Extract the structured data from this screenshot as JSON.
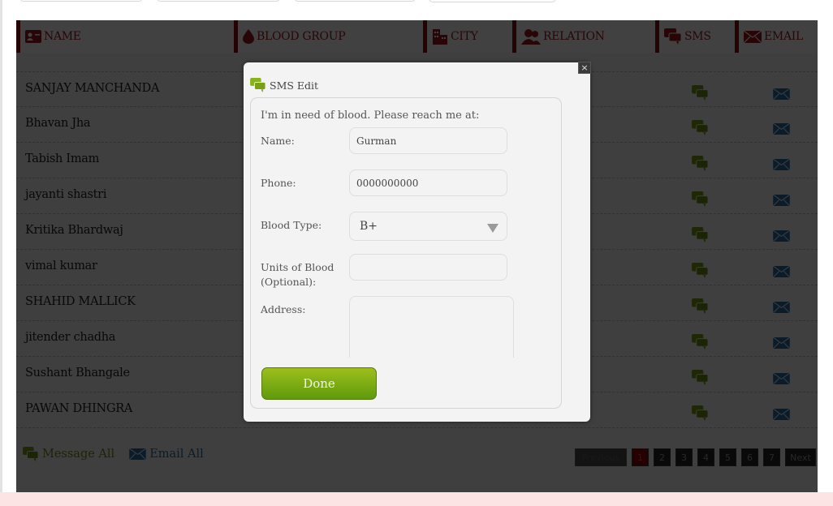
{
  "table": {
    "headers": [
      {
        "key": "name",
        "label": "NAME",
        "icon": "contact-card-icon"
      },
      {
        "key": "blood",
        "label": "BLOOD GROUP",
        "icon": "blood-drop-icon"
      },
      {
        "key": "city",
        "label": "CITY",
        "icon": "buildings-icon"
      },
      {
        "key": "relation",
        "label": "RELATION",
        "icon": "people-icon"
      },
      {
        "key": "sms",
        "label": "SMS",
        "icon": "chat-bubbles-icon"
      },
      {
        "key": "email",
        "label": "EMAIL",
        "icon": "envelope-icon"
      }
    ],
    "rows": [
      {
        "name": "SANJAY MANCHANDA"
      },
      {
        "name": "Bhavan Jha"
      },
      {
        "name": "Tabish Imam"
      },
      {
        "name": "jayanti shastri"
      },
      {
        "name": "Kritika Bhardwaj"
      },
      {
        "name": "vimal kumar"
      },
      {
        "name": "SHAHID MALLICK"
      },
      {
        "name": "jitender chadha"
      },
      {
        "name": "Sushant Bhangale"
      },
      {
        "name": "PAWAN DHINGRA"
      }
    ]
  },
  "footer": {
    "message_all": "Message All",
    "email_all": "Email All"
  },
  "pagination": {
    "previous": "Previous",
    "pages": [
      "1",
      "2",
      "3",
      "4",
      "5",
      "6",
      "7"
    ],
    "current": "1",
    "next": "Next"
  },
  "modal": {
    "title": "SMS Edit",
    "close": "×",
    "intro": "I'm in need of blood. Please reach me at:",
    "name_label": "Name:",
    "name_value": "Gurman",
    "phone_label": "Phone:",
    "phone_value": "0000000000",
    "blood_label": "Blood Type:",
    "blood_value": "B+",
    "units_label_1": "Units of Blood",
    "units_label_2": "(Optional):",
    "units_value": "",
    "address_label": "Address:",
    "address_value": "",
    "done_label": "Done"
  },
  "colors": {
    "header_accent": "#8e0f13",
    "sms_green": "#7a9a1a",
    "email_blue": "#2b6e9a",
    "done_green": "#7fae14",
    "page_active": "#8c0000"
  }
}
